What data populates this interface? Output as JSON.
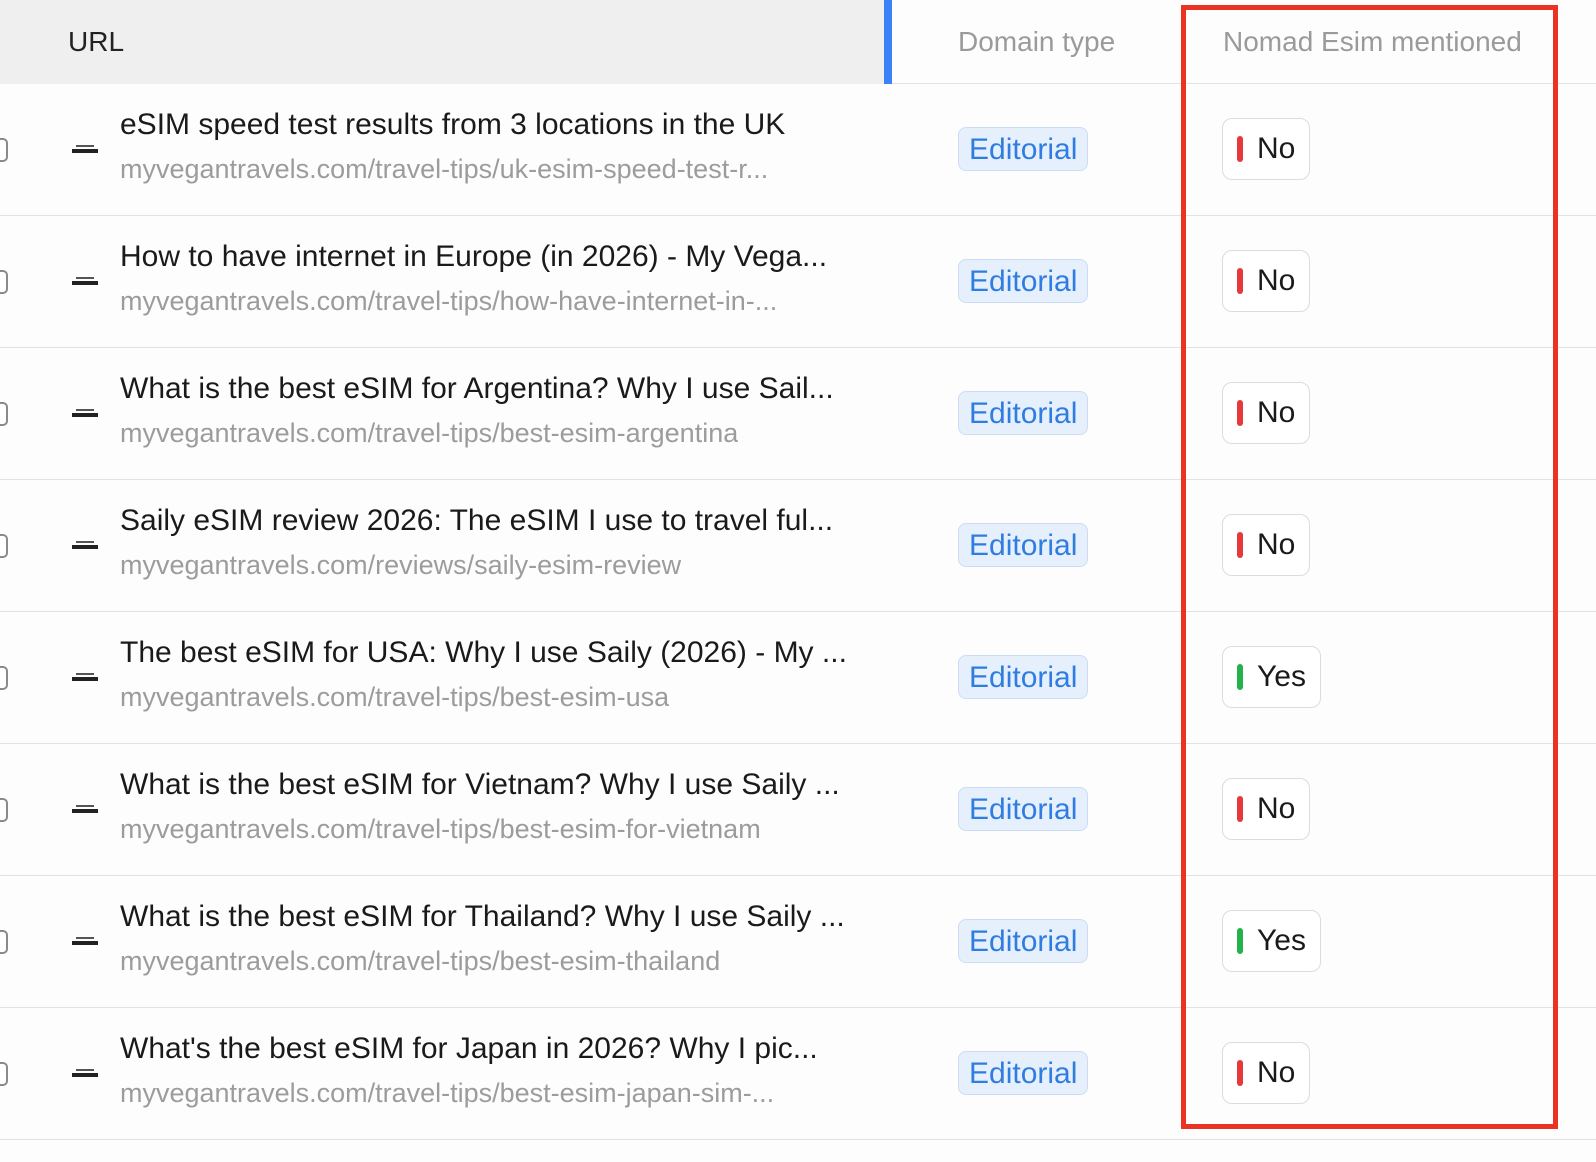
{
  "header": {
    "url_label": "URL",
    "domain_type_label": "Domain type",
    "nomad_label": "Nomad Esim mentioned"
  },
  "colors": {
    "no": "#e5393b",
    "yes": "#23b24b",
    "highlight": "#ea3323",
    "accent": "#3b82f6"
  },
  "favicon_icon": "myvegantravels-logo-icon",
  "rows": [
    {
      "title": "eSIM speed test results from 3 locations in the UK",
      "url": "myvegantravels.com/travel-tips/uk-esim-speed-test-r...",
      "domain_type": "Editorial",
      "mentioned": "No"
    },
    {
      "title": "How to have internet in Europe (in 2026) - My Vega...",
      "url": "myvegantravels.com/travel-tips/how-have-internet-in-...",
      "domain_type": "Editorial",
      "mentioned": "No"
    },
    {
      "title": "What is the best eSIM for Argentina? Why I use Sail...",
      "url": "myvegantravels.com/travel-tips/best-esim-argentina",
      "domain_type": "Editorial",
      "mentioned": "No"
    },
    {
      "title": "Saily eSIM review 2026: The eSIM I use to travel ful...",
      "url": "myvegantravels.com/reviews/saily-esim-review",
      "domain_type": "Editorial",
      "mentioned": "No"
    },
    {
      "title": "The best eSIM for USA: Why I use Saily (2026) - My ...",
      "url": "myvegantravels.com/travel-tips/best-esim-usa",
      "domain_type": "Editorial",
      "mentioned": "Yes"
    },
    {
      "title": "What is the best eSIM for Vietnam? Why I use Saily ...",
      "url": "myvegantravels.com/travel-tips/best-esim-for-vietnam",
      "domain_type": "Editorial",
      "mentioned": "No"
    },
    {
      "title": "What is the best eSIM for Thailand? Why I use Saily ...",
      "url": "myvegantravels.com/travel-tips/best-esim-thailand",
      "domain_type": "Editorial",
      "mentioned": "Yes"
    },
    {
      "title": "What's the best eSIM for Japan in 2026? Why I pic...",
      "url": "myvegantravels.com/travel-tips/best-esim-japan-sim-...",
      "domain_type": "Editorial",
      "mentioned": "No"
    }
  ]
}
